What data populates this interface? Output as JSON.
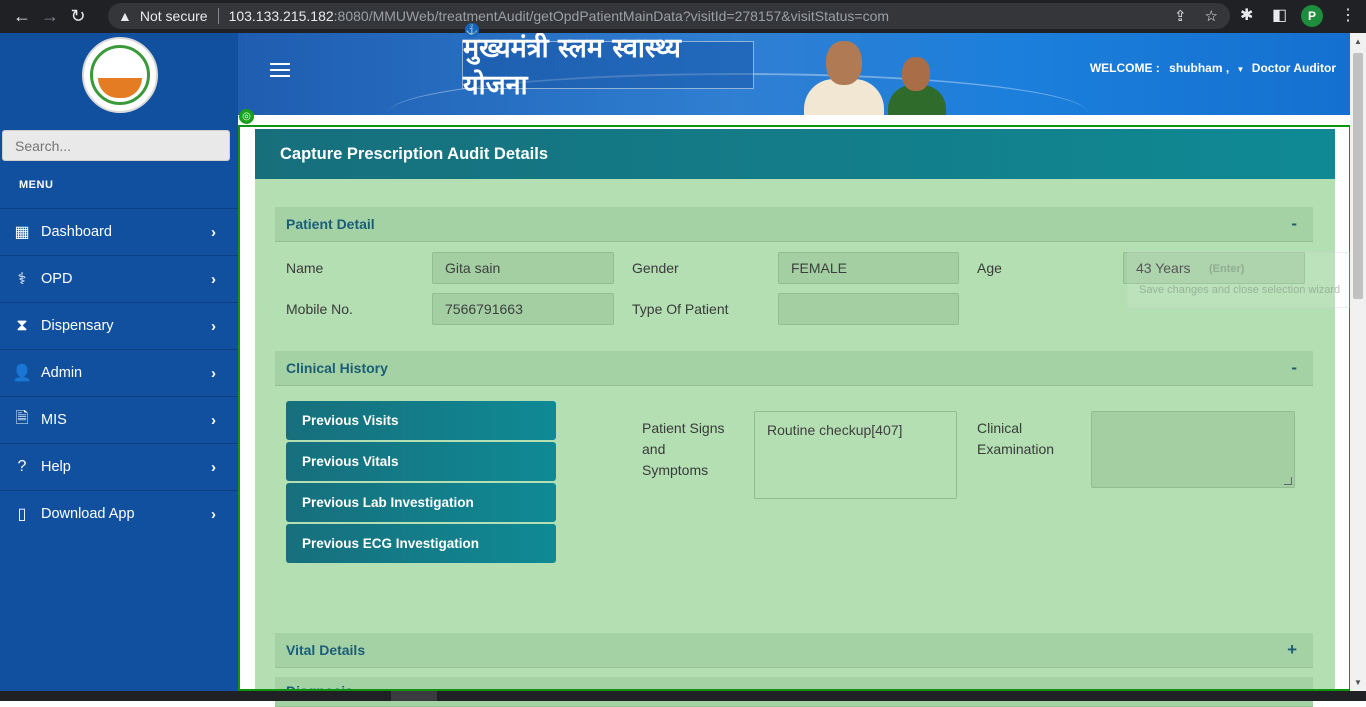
{
  "browser": {
    "security_label": "Not secure",
    "url_host": "103.133.215.182",
    "url_path": ":8080/MMUWeb/treatmentAudit/getOpdPatientMainData?visitId=278157&visitStatus=com",
    "profile_initial": "P"
  },
  "sidebar": {
    "search_placeholder": "Search...",
    "menu_title": "MENU",
    "items": [
      {
        "label": "Dashboard",
        "icon": "building-icon",
        "glyph": "▦"
      },
      {
        "label": "OPD",
        "icon": "doctor-icon",
        "glyph": "⚕"
      },
      {
        "label": "Dispensary",
        "icon": "hourglass-icon",
        "glyph": "⧗"
      },
      {
        "label": "Admin",
        "icon": "user-shield-icon",
        "glyph": "👤"
      },
      {
        "label": "MIS",
        "icon": "file-plus-icon",
        "glyph": "🗎"
      },
      {
        "label": "Help",
        "icon": "question-circle-icon",
        "glyph": "?"
      },
      {
        "label": "Download App",
        "icon": "mobile-icon",
        "glyph": "▯"
      }
    ]
  },
  "header": {
    "scheme_title": "मुख्यमंत्री स्लम स्वास्थ्य योजना",
    "welcome_label": "WELCOME :",
    "user_name": "shubham ,",
    "role": "Doctor Auditor"
  },
  "main": {
    "card_title": "Capture Prescription Audit Details",
    "patient_detail": {
      "title": "Patient Detail",
      "toggle": "-",
      "name_label": "Name",
      "name_value": "Gita sain",
      "gender_label": "Gender",
      "gender_value": "FEMALE",
      "age_label": "Age",
      "age_value": "43 Years",
      "mobile_label": "Mobile No.",
      "mobile_value": "7566791663",
      "type_label": "Type Of Patient",
      "type_value": ""
    },
    "clinical_history": {
      "title": "Clinical History",
      "toggle": "-",
      "buttons": [
        "Previous Visits",
        "Previous Vitals",
        "Previous Lab Investigation",
        "Previous ECG Investigation"
      ],
      "signs_label_1": "Patient Signs",
      "signs_label_2": "and",
      "signs_label_3": "Symptoms",
      "signs_value": "Routine checkup[407]",
      "exam_label_1": "Clinical",
      "exam_label_2": "Examination",
      "exam_value": ""
    },
    "vital_details": {
      "title": "Vital Details",
      "toggle": "+"
    },
    "diagnosis": {
      "title": "Diagnosis"
    }
  },
  "overlay": {
    "line1": "(Enter)",
    "line2": "Save changes and close selection wizard"
  }
}
